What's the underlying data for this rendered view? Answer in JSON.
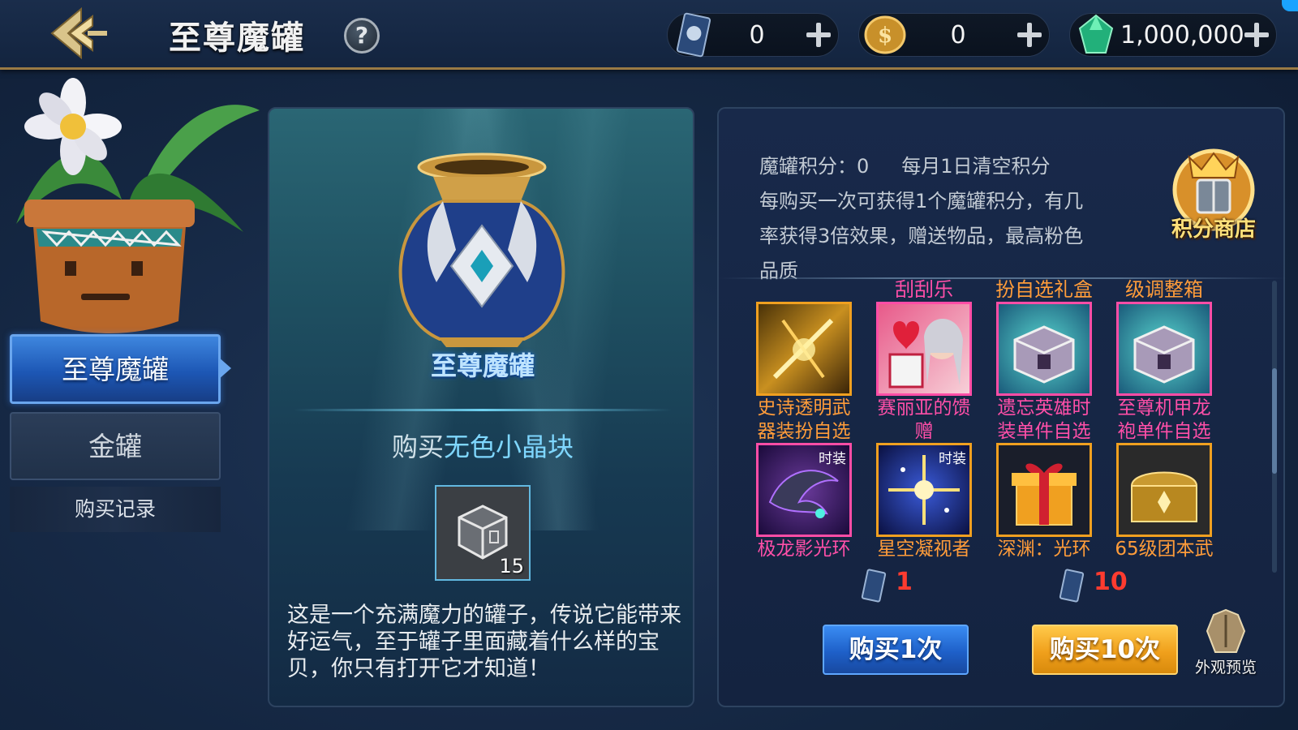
{
  "header": {
    "title": "至尊魔罐",
    "help_symbol": "?",
    "currencies": [
      {
        "name": "card-ticket",
        "value": "0"
      },
      {
        "name": "gold-coin",
        "value": "0"
      },
      {
        "name": "diamond",
        "value": "1,000,000"
      }
    ]
  },
  "sidebar": {
    "tabs": [
      {
        "label": "至尊魔罐",
        "active": true
      },
      {
        "label": "金罐",
        "active": false
      }
    ],
    "record_label": "购买记录"
  },
  "jar_panel": {
    "jar_name": "至尊魔罐",
    "buy_prefix": "购买",
    "buy_item": "无色小晶块",
    "item_count": "15",
    "description": "这是一个充满魔力的罐子，传说它能带来好运气，至于罐子里面藏着什么样的宝贝，你只有打开它才知道！"
  },
  "info": {
    "points_label": "魔罐积分：",
    "points_value": "0",
    "reset_note": "每月1日清空积分",
    "line2": "每购买一次可获得1个魔罐积分，有几",
    "line3": "率获得3倍效果，赠送物品，最高粉色",
    "line4": "品质",
    "shop_label": "积分商店"
  },
  "rewards": [
    {
      "above": "",
      "name_l1": "史诗透明武",
      "name_l2": "器装扮自选",
      "color": "orange",
      "icon": "weapon-skin-icon"
    },
    {
      "above": "刮刮乐",
      "name_l1": "赛丽亚的馈",
      "name_l2": "赠",
      "color": "pink",
      "icon": "seria-gift-icon"
    },
    {
      "above": "扮自选礼盒",
      "name_l1": "遗忘英雄时",
      "name_l2": "装单件自选",
      "color": "pink",
      "icon": "chest-icon"
    },
    {
      "above": "级调整箱",
      "name_l1": "至尊机甲龙",
      "name_l2": "袍单件自选",
      "color": "pink",
      "icon": "chest-icon"
    },
    {
      "above": "",
      "name_l1": "极龙影光环",
      "name_l2": "",
      "color": "pink",
      "icon": "dragon-aura-icon",
      "badge": "时装"
    },
    {
      "above": "",
      "name_l1": "星空凝视者",
      "name_l2": "",
      "color": "orange",
      "icon": "starry-gazer-icon",
      "badge": "时装"
    },
    {
      "above": "",
      "name_l1": "深渊：光环",
      "name_l2": "",
      "color": "orange",
      "icon": "gift-box-icon"
    },
    {
      "above": "",
      "name_l1": "65级团本武",
      "name_l2": "",
      "color": "orange",
      "icon": "golden-chest-icon"
    }
  ],
  "purchase": {
    "buy1_cost": "1",
    "buy10_cost": "10",
    "buy1_label": "购买1次",
    "buy10_label": "购买10次",
    "preview_label": "外观预览"
  },
  "colors": {
    "accent_blue": "#1e60c9",
    "accent_gold": "#f0a01c",
    "rarity_orange": "#ff9c3a",
    "rarity_pink": "#ff4fa8",
    "cost_red": "#ff3b2f"
  }
}
